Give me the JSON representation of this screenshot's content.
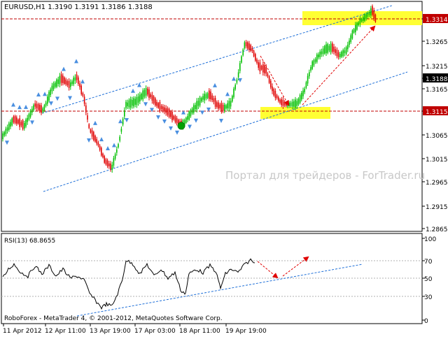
{
  "main_chart": {
    "header": "EURUSD,H1  1.3190 1.3191 1.3186 1.3188",
    "watermark": "Портал для трейдеров - ForTrader.ru",
    "price_ticks": [
      "1.3314",
      "1.3265",
      "1.3215",
      "1.3188",
      "1.3165",
      "1.3115",
      "1.3065",
      "1.3015",
      "1.2965",
      "1.2915",
      "1.2865"
    ],
    "highlighted_prices": [
      "1.3314",
      "1.3188",
      "1.3115"
    ],
    "current_price": "1.3188",
    "levels": {
      "resistance": "1.3314",
      "support": "1.3115"
    },
    "colors": {
      "bull": "#00c000",
      "bear": "#e00000",
      "fractal": "#4a8fe0",
      "channel": "#1e6fd8",
      "level": "#c00000",
      "zone": "#ffff33",
      "arrow": "#e00000"
    }
  },
  "rsi_panel": {
    "header": "RSI(13) 68.8655",
    "ticks": [
      "100",
      "70",
      "50",
      "30",
      "0"
    ],
    "footer": "RoboForex - MetaTrader 4, © 2001-2012, MetaQuotes Software Corp."
  },
  "time_axis": {
    "labels": [
      "11 Apr 2012",
      "12 Apr 11:00",
      "13 Apr 19:00",
      "17 Apr 03:00",
      "18 Apr 11:00",
      "19 Apr 19:00"
    ]
  }
}
